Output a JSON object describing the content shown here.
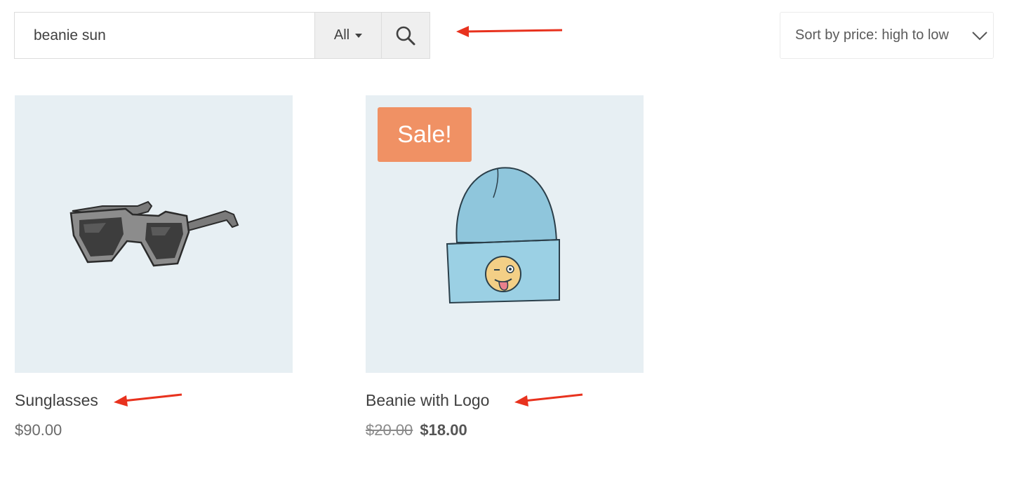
{
  "search": {
    "value": "beanie sun",
    "placeholder": "",
    "category": "All",
    "search_icon": "search-icon"
  },
  "sort": {
    "selected": "Sort by price: high to low",
    "icon": "chevron-down-icon"
  },
  "products": [
    {
      "title": "Sunglasses",
      "image_icon": "sunglasses-illustration",
      "price": "$90.00"
    },
    {
      "title": "Beanie with Logo",
      "image_icon": "beanie-illustration",
      "badge": "Sale!",
      "price_regular": "$20.00",
      "price_sale": "$18.00"
    }
  ],
  "colors": {
    "sale_badge": "#f09164",
    "annotation_arrow": "#e8321e",
    "image_bg": "#e7eff3"
  }
}
